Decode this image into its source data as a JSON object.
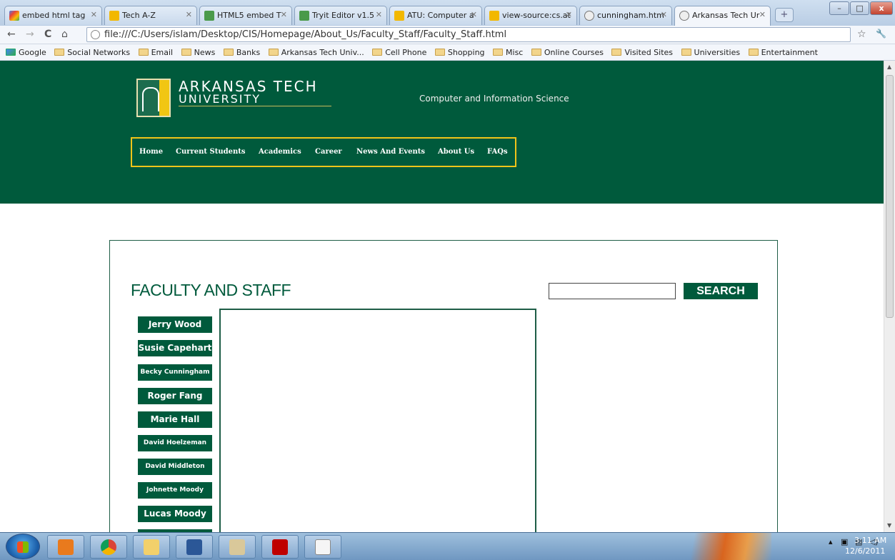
{
  "browser": {
    "tabs": [
      {
        "title": "embed html tag",
        "active": false
      },
      {
        "title": "Tech A-Z",
        "active": false
      },
      {
        "title": "HTML5 embed T",
        "active": false
      },
      {
        "title": "Tryit Editor v1.5",
        "active": false
      },
      {
        "title": "ATU: Computer a",
        "active": false
      },
      {
        "title": "view-source:cs.at",
        "active": false
      },
      {
        "title": "cunningham.htm",
        "active": false
      },
      {
        "title": "Arkansas Tech Ur",
        "active": true
      }
    ],
    "new_tab_label": "+",
    "url": "file:///C:/Users/islam/Desktop/CIS/Homepage/About_Us/Faculty_Staff/Faculty_Staff.html",
    "nav": {
      "back": "←",
      "forward": "→",
      "reload": "C",
      "home": "⌂",
      "star": "☆",
      "wrench": "🔧"
    },
    "window_controls": {
      "minimize": "–",
      "maximize": "□",
      "close": "x"
    },
    "bookmarks": [
      "Google",
      "Social Networks",
      "Email",
      "News",
      "Banks",
      "Arkansas Tech Univ...",
      "Cell Phone",
      "Shopping",
      "Misc",
      "Online Courses",
      "Visited Sites",
      "Universities",
      "Entertainment"
    ]
  },
  "site": {
    "logo_line1": "ARKANSAS TECH",
    "logo_line2": "UNIVERSITY",
    "department": "Computer and Information Science",
    "nav": [
      "Home",
      "Current Students",
      "Academics",
      "Career",
      "News And Events",
      "About Us",
      "FAQs"
    ],
    "colors": {
      "brand_green": "#005a3c",
      "nav_border_gold": "#f0c419"
    }
  },
  "content": {
    "title": "FACULTY AND STAFF",
    "search_button": "SEARCH",
    "search_value": "",
    "people": [
      {
        "name": "Jerry Wood",
        "size": "big"
      },
      {
        "name": "Susie Capehart",
        "size": "big"
      },
      {
        "name": "Becky Cunningham",
        "size": "small"
      },
      {
        "name": "Roger Fang",
        "size": "big"
      },
      {
        "name": "Marie Hall",
        "size": "big"
      },
      {
        "name": "David Hoelzeman",
        "size": "small"
      },
      {
        "name": "David Middleton",
        "size": "small"
      },
      {
        "name": "Johnette Moody",
        "size": "small"
      },
      {
        "name": "Lucas Moody",
        "size": "big"
      }
    ]
  },
  "taskbar": {
    "time": "3:11 AM",
    "date": "12/6/2011",
    "apps": [
      "outlook",
      "chrome",
      "explorer",
      "word",
      "file-manager",
      "filezilla",
      "notepad"
    ]
  }
}
